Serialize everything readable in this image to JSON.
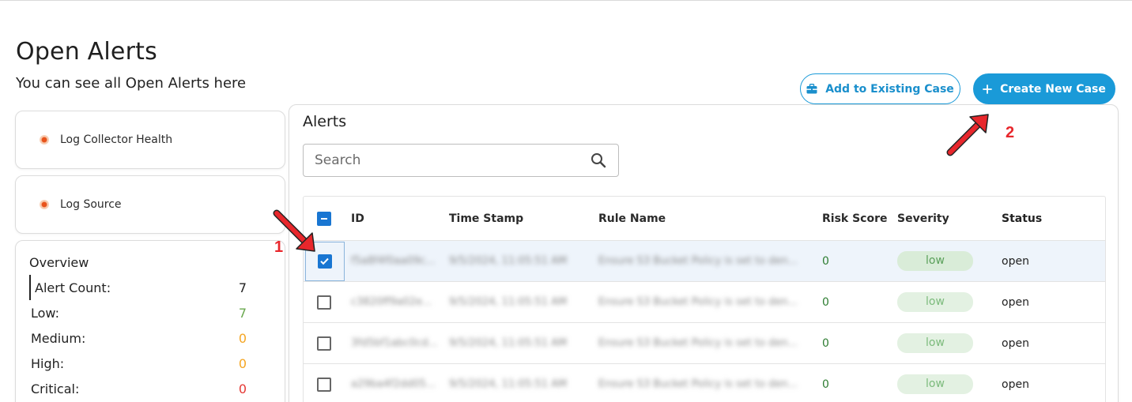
{
  "page": {
    "title": "Open Alerts",
    "subtitle": "You can see all Open Alerts here"
  },
  "sidebar": {
    "status_cards": [
      {
        "label": "Log Collector Health",
        "icon": "status-dot-icon"
      },
      {
        "label": "Log Source",
        "icon": "status-dot-icon"
      }
    ],
    "overview": {
      "title": "Overview",
      "rows": [
        {
          "label": "Alert Count:",
          "value": "7",
          "color": "#222222"
        },
        {
          "label": "Low:",
          "value": "7",
          "color": "#6aa84f"
        },
        {
          "label": "Medium:",
          "value": "0",
          "color": "#f5a623"
        },
        {
          "label": "High:",
          "value": "0",
          "color": "#f5a623"
        },
        {
          "label": "Critical:",
          "value": "0",
          "color": "#e53935"
        }
      ]
    }
  },
  "actions": {
    "add_existing_label": "Add to Existing Case",
    "add_existing_icon": "briefcase-icon",
    "create_new_label": "Create New Case",
    "create_new_icon": "plus-icon"
  },
  "alerts": {
    "title": "Alerts",
    "search": {
      "placeholder": "Search",
      "value": ""
    },
    "columns": [
      "ID",
      "Time Stamp",
      "Rule Name",
      "Risk Score",
      "Severity",
      "Status"
    ],
    "rows": [
      {
        "selected": true,
        "id": "f5a8f4f0aa09c...",
        "timestamp": "9/5/2024, 11:05:51 AM",
        "rule": "Ensure S3 Bucket Policy is set to den...",
        "risk": "0",
        "severity": "low",
        "status": "open"
      },
      {
        "selected": false,
        "id": "c3820ff9a02e...",
        "timestamp": "9/5/2024, 11:05:51 AM",
        "rule": "Ensure S3 Bucket Policy is set to den...",
        "risk": "0",
        "severity": "low",
        "status": "open"
      },
      {
        "selected": false,
        "id": "3fd5bf1abc0cd...",
        "timestamp": "9/5/2024, 11:05:51 AM",
        "rule": "Ensure S3 Bucket Policy is set to den...",
        "risk": "0",
        "severity": "low",
        "status": "open"
      },
      {
        "selected": false,
        "id": "a29ba4f2dd05...",
        "timestamp": "9/5/2024, 11:05:51 AM",
        "rule": "Ensure S3 Bucket Policy is set to den...",
        "risk": "0",
        "severity": "low",
        "status": "open"
      }
    ]
  },
  "annotations": {
    "step1": "1",
    "step2": "2",
    "color": "#e8272c"
  }
}
